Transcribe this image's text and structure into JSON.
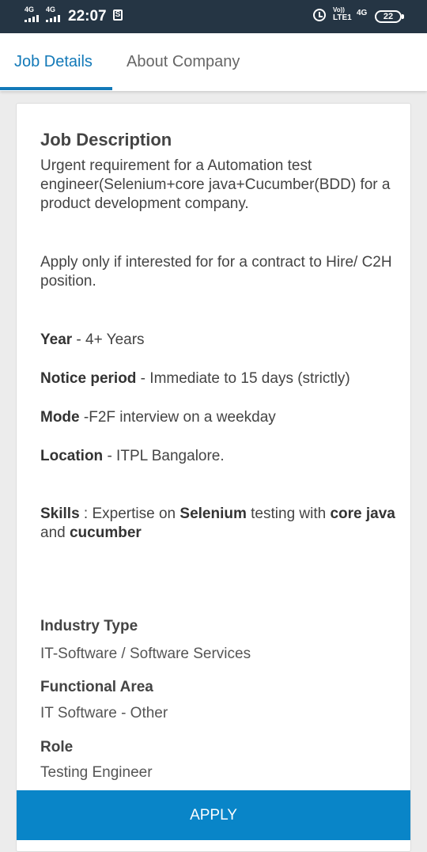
{
  "status_bar": {
    "sim1": "4G",
    "sim2": "4G",
    "time": "22:07",
    "volte": "Vo))",
    "lte": "LTE1",
    "network": "4G",
    "battery": "22"
  },
  "tabs": [
    {
      "label": "Job Details",
      "active": true
    },
    {
      "label": "About Company",
      "active": false
    }
  ],
  "job": {
    "section_title": "Job Description",
    "intro": "Urgent requirement for a Automation test engineer(Selenium+core java+Cucumber(BDD) for a product development company.",
    "apply_note": "Apply only if interested for for a contract to Hire/ C2H position.",
    "year_label": "Year",
    "year_value": " - 4+ Years",
    "notice_label": "Notice period",
    "notice_value": " - Immediate to 15 days (strictly)",
    "mode_label": "Mode",
    "mode_value": " -F2F interview on a weekday",
    "location_label": "Location",
    "location_value": " - ITPL Bangalore.",
    "skills_label": "Skills",
    "skills_t1": " : Expertise on ",
    "skills_b1": "Selenium",
    "skills_t2": " testing with ",
    "skills_b2": "core java",
    "skills_t3": " and ",
    "skills_b3": "cucumber"
  },
  "details": {
    "industry_label": "Industry Type",
    "industry_value": "IT-Software / Software Services",
    "functional_label": "Functional Area",
    "functional_value": "IT Software - Other",
    "role_label": "Role",
    "role_value": "Testing Engineer"
  },
  "apply_button": "APPLY",
  "colors": {
    "accent": "#1279b8",
    "apply": "#0985c8",
    "status_bar": "#253544"
  }
}
